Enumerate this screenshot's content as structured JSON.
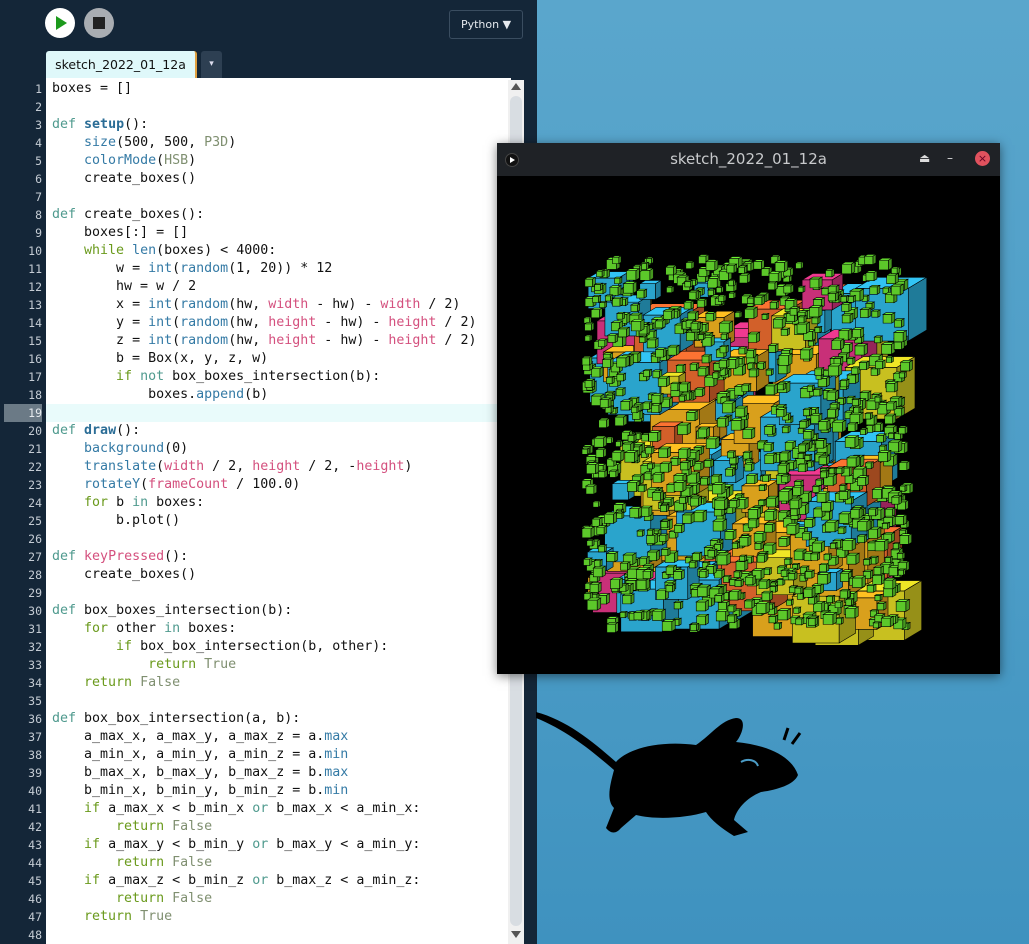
{
  "toolbar": {
    "run_icon": "play-icon",
    "stop_icon": "stop-icon",
    "mode_label": "Python ▼"
  },
  "tab": {
    "label": "sketch_2022_01_12a",
    "menu_glyph": "▾"
  },
  "editor": {
    "current_line": 19,
    "lines": [
      "boxes = []",
      "",
      "def setup():",
      "    size(500, 500, P3D)",
      "    colorMode(HSB)",
      "    create_boxes()",
      "",
      "def create_boxes():",
      "    boxes[:] = []",
      "    while len(boxes) < 4000:",
      "        w = int(random(1, 20)) * 12",
      "        hw = w / 2",
      "        x = int(random(hw, width - hw) - width / 2)",
      "        y = int(random(hw, height - hw) - height / 2)",
      "        z = int(random(hw, height - hw) - height / 2)",
      "        b = Box(x, y, z, w)",
      "        if not box_boxes_intersection(b):",
      "            boxes.append(b)",
      "",
      "def draw():",
      "    background(0)",
      "    translate(width / 2, height / 2, -height)",
      "    rotateY(frameCount / 100.0)",
      "    for b in boxes:",
      "        b.plot()",
      "",
      "def keyPressed():",
      "    create_boxes()",
      "",
      "def box_boxes_intersection(b):",
      "    for other in boxes:",
      "        if box_box_intersection(b, other):",
      "            return True",
      "    return False",
      "",
      "def box_box_intersection(a, b):",
      "    a_max_x, a_max_y, a_max_z = a.max",
      "    a_min_x, a_min_y, a_min_z = a.min",
      "    b_max_x, b_max_y, b_max_z = b.max",
      "    b_min_x, b_min_y, b_min_z = b.min",
      "    if a_max_x < b_min_x or b_max_x < a_min_x:",
      "        return False",
      "    if a_max_y < b_min_y or b_max_y < a_min_y:",
      "        return False",
      "    if a_max_z < b_min_z or b_max_z < a_min_z:",
      "        return False",
      "    return True",
      ""
    ]
  },
  "sketch_window": {
    "title": "sketch_2022_01_12a",
    "eject_glyph": "⏏",
    "minimize_glyph": "–",
    "close_glyph": "×"
  },
  "colors": {
    "box_colors": [
      "#2aa4cc",
      "#d9a01c",
      "#5cc82a",
      "#d2602a",
      "#c8c020",
      "#c83078"
    ],
    "accent": "#1c9a1c"
  }
}
